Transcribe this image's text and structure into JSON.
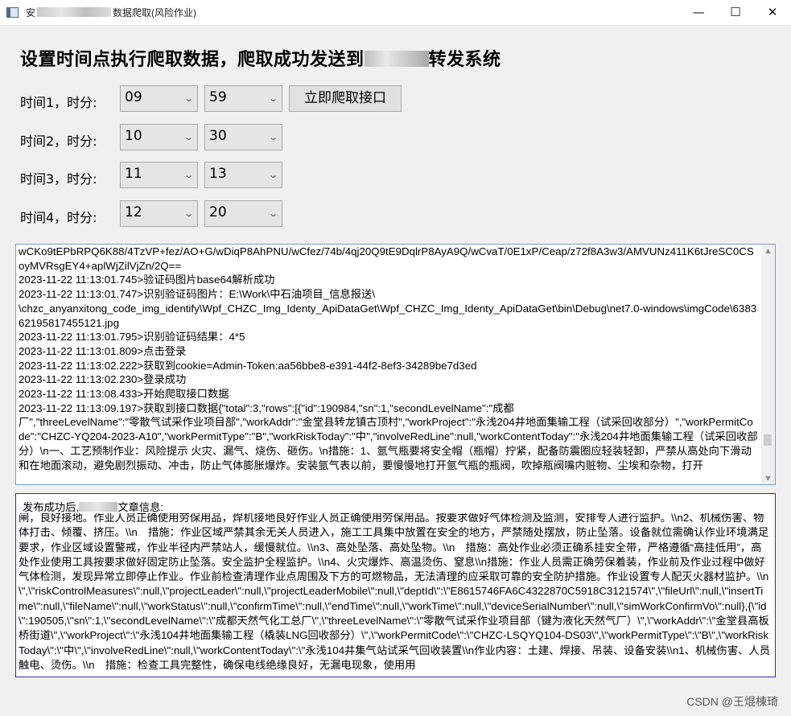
{
  "window": {
    "title_prefix": "安",
    "title_suffix": "数据爬取(风险作业)",
    "minimize_glyph": "—",
    "maximize_glyph": "☐",
    "close_glyph": "✕"
  },
  "heading": {
    "prefix": "设置时间点执行爬取数据，爬取成功发送到",
    "suffix": "转发系统"
  },
  "schedule": [
    {
      "label": "时间1，时分:",
      "hour": "09",
      "minute": "59"
    },
    {
      "label": "时间2，时分:",
      "hour": "10",
      "minute": "30"
    },
    {
      "label": "时间3，时分:",
      "hour": "11",
      "minute": "13"
    },
    {
      "label": "时间4，时分:",
      "hour": "12",
      "minute": "20"
    }
  ],
  "fetch_button": "立即爬取接口",
  "combo_arrow_icon": "chevron-down-icon",
  "log_lines": [
    "wCKo9tEPbRPQ6K88/4TzVP+fez/AO+G/wDiqP8AhPNU/wCfez/74b/4qj20Q9tE9DqlrP8AyA9Q/wCvaT/0E1xP/Ceap/z72f8A3w3/AMVUNz411K6tJreSC0CSoyMVRsgEY4+aplWjZilVjZn/2Q==",
    "2023-11-22 11:13:01.745>验证码图片base64解析成功",
    "2023-11-22 11:13:01.747>识别验证码图片：E:\\Work\\中石油项目_信息报送\\",
    "\\chzc_anyanxitong_code_img_identify\\Wpf_CHZC_Img_Identy_ApiDataGet\\Wpf_CHZC_Img_Identy_ApiDataGet\\bin\\Debug\\net7.0-windows\\imgCode\\638362195817455121.jpg",
    "2023-11-22 11:13:01.795>识别验证码结果：4*5",
    "2023-11-22 11:13:01.809>点击登录",
    "2023-11-22 11:13:02.222>获取到cookie=Admin-Token:aa56bbe8-e391-44f2-8ef3-34289be7d3ed",
    "2023-11-22 11:13:02.230>登录成功",
    "2023-11-22 11:13:08.433>开始爬取接口数据",
    "2023-11-22 11:13:09.197>获取到接口数据{\"total\":3,\"rows\":[{\"id\":190984,\"sn\":1,\"secondLevelName\":\"成都",
    "厂\",\"threeLevelName\":\"零散气试采作业项目部\",\"workAddr\":\"金堂县转龙镇古顶村\",\"workProject\":\"永浅204井地面集输工程（试采回收部分）\",\"workPermitCode\":\"CHZC-YQ204-2023-A10\",\"workPermitType\":\"B\",\"workRiskToday\":\"中\",\"involveRedLine\":null,\"workContentToday\":\"永浅204井地面集输工程（试采回收部分）\\n一、工艺预制作业：风险提示 火灾、漏气、烧伤、砸伤。\\n措施：1、氩气瓶要将安全帽（瓶帽）拧紧，配备防震圈应轻装轻卸，严禁从高处向下滑动和在地面滚动，避免剧烈振动、冲击，防止气体膨胀爆炸。安装氩气表以前，要慢慢地打开氩气瓶的瓶阀，吹掉瓶阀嘴内赃物、尘埃和杂物，打开"
  ],
  "publish": {
    "title_prefix": "发布成功后,",
    "title_suffix": "文章信息:",
    "response": "闸，良好接地。作业人员正确使用劳保用品，焊机接地良好作业人员正确使用劳保用品。按要求做好气体检测及监测，安排专人进行监护。\\\\n2、机械伤害、物体打击、倾覆、挤压。\\\\n　措施：作业区域严禁其余无关人员进入，施工工具集中放置在安全的地方，严禁随处摆放，防止坠落。设备就位需确认作业环境满足要求，作业区域设置警戒，作业半径内严禁站人，缓慢就位。\\\\n3、高处坠落、高处坠物。\\\\n　措施：高处作业必须正确系挂安全带，严格遵循“高挂低用”，高处作业使用工具按要求做好固定防止坠落。安全监护全程监护。\\\\n4、火灾爆炸、高温烫伤、窒息\\\\n措施：作业人员需正确劳保着装，作业前及作业过程中做好气体检测，发现异常立即停止作业。作业前检查清理作业点周围及下方的可燃物品，无法清理的应采取可靠的安全防护措施。作业设置专人配灭火器材监护。\\\\n\\\",\\\"riskControlMeasures\\\":null,\\\"projectLeader\\\":null,\\\"projectLeaderMobile\\\":null,\\\"deptId\\\":\\\"E8615746FA6C4322870C5918C3121574\\\",\\\"fileUrl\\\":null,\\\"insertTime\\\":null,\\\"fileName\\\":null,\\\"workStatus\\\":null,\\\"confirmTime\\\":null,\\\"endTime\\\":null,\\\"workTime\\\":null,\\\"deviceSerialNumber\\\":null,\\\"simWorkConfirmVo\\\":null},{\\\"id\\\":190505,\\\"sn\\\":1,\\\"secondLevelName\\\":\\\"成都天然气化工总厂\\\",\\\"threeLevelName\\\":\\\"零散气试采作业项目部（键为液化天然气厂）\\\",\\\"workAddr\\\":\\\"金堂县高板桥街道\\\",\\\"workProject\\\":\\\"永浅104井地面集输工程（橇装LNG回收部分）\\\",\\\"workPermitCode\\\":\\\"CHZC-LSQYQ104-DS03\\\",\\\"workPermitType\\\":\\\"B\\\",\\\"workRiskToday\\\":\\\"中\\\",\\\"involveRedLine\\\":null,\\\"workContentToday\\\":\\\"永浅104井集气站试采气回收装置\\\\n作业内容：土建、焊接、吊装、设备安装\\\\n1、机械伤害、人员触电、烫伤。\\\\n　措施：检查工具完整性，确保电线绝缘良好，无漏电现象，使用用"
  },
  "watermark": "CSDN @王焜棟琦"
}
